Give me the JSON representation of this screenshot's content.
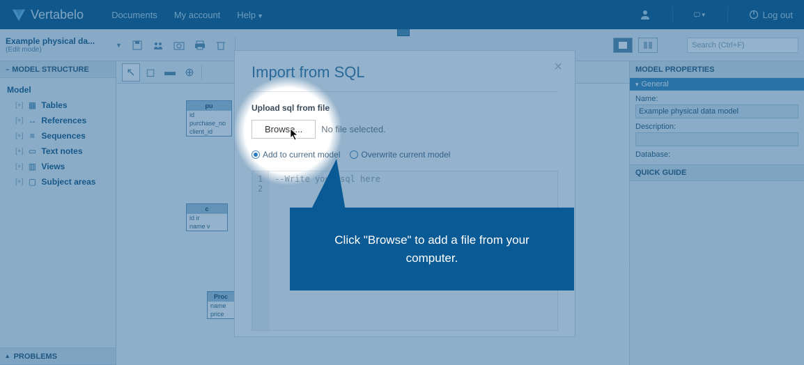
{
  "brand": "Vertabelo",
  "topnav": {
    "documents": "Documents",
    "account": "My account",
    "help": "Help"
  },
  "logout": "Log out",
  "doc": {
    "title": "Example physical da...",
    "subtitle": "(Edit mode)"
  },
  "search": {
    "placeholder": "Search (Ctrl+F)"
  },
  "left_panel": {
    "structure": "MODEL STRUCTURE",
    "root": "Model",
    "items": [
      "Tables",
      "References",
      "Sequences",
      "Text notes",
      "Views",
      "Subject areas"
    ],
    "problems": "PROBLEMS"
  },
  "right_panel": {
    "properties": "MODEL PROPERTIES",
    "general": "General",
    "name_label": "Name:",
    "name_value": "Example physical data model",
    "desc_label": "Description:",
    "db_label": "Database:",
    "quick_guide": "QUICK GUIDE"
  },
  "canvas": {
    "t1": {
      "title": "pu",
      "rows": [
        "id",
        "purchase_no",
        "client_id"
      ]
    },
    "t2": {
      "title": "c",
      "rows": [
        "id     ir",
        "name   v"
      ]
    },
    "t3": {
      "title": "Proc",
      "rows": [
        "name",
        "price"
      ]
    }
  },
  "modal": {
    "title": "Import from SQL",
    "upload_label": "Upload sql from file",
    "browse": "Browse...",
    "no_file": "No file selected.",
    "radio_add": "Add to current model",
    "radio_overwrite": "Overwrite current model",
    "gutter": [
      "1",
      "2"
    ],
    "placeholder": "--Write your sql here"
  },
  "callout": "Click \"Browse\" to add a file from your computer."
}
